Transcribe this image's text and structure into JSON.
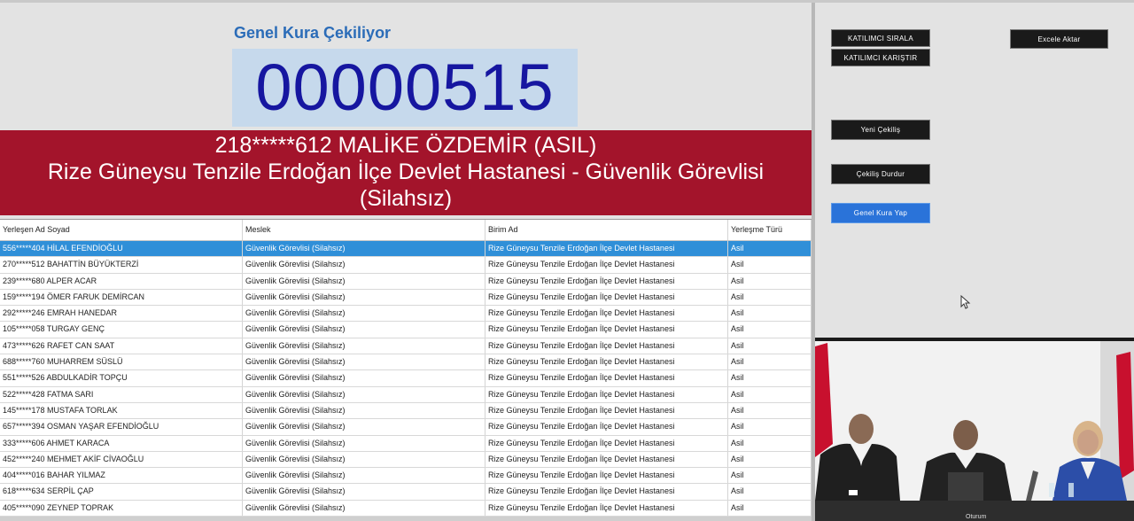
{
  "draw": {
    "title": "Genel Kura Çekiliyor",
    "counter": "00000515",
    "winner_line1": "218*****612 MALİKE ÖZDEMİR (ASIL)",
    "winner_line2": "Rize Güneysu Tenzile Erdoğan İlçe Devlet Hastanesi - Güvenlik Görevlisi",
    "winner_line3": "(Silahsız)"
  },
  "table": {
    "headers": [
      "Yerleşen Ad Soyad",
      "Meslek",
      "Birim Ad",
      "Yerleşme Türü"
    ],
    "rows": [
      [
        "556*****404 HİLAL EFENDİOĞLU",
        "Güvenlik Görevlisi (Silahsız)",
        "Rize Güneysu Tenzile Erdoğan İlçe Devlet Hastanesi",
        "Asil"
      ],
      [
        "270*****512 BAHATTİN BÜYÜKTERZİ",
        "Güvenlik Görevlisi (Silahsız)",
        "Rize Güneysu Tenzile Erdoğan İlçe Devlet Hastanesi",
        "Asil"
      ],
      [
        "239*****680 ALPER ACAR",
        "Güvenlik Görevlisi (Silahsız)",
        "Rize Güneysu Tenzile Erdoğan İlçe Devlet Hastanesi",
        "Asil"
      ],
      [
        "159*****194 ÖMER FARUK DEMİRCAN",
        "Güvenlik Görevlisi (Silahsız)",
        "Rize Güneysu Tenzile Erdoğan İlçe Devlet Hastanesi",
        "Asil"
      ],
      [
        "292*****246 EMRAH HANEDAR",
        "Güvenlik Görevlisi (Silahsız)",
        "Rize Güneysu Tenzile Erdoğan İlçe Devlet Hastanesi",
        "Asil"
      ],
      [
        "105*****058 TURGAY GENÇ",
        "Güvenlik Görevlisi (Silahsız)",
        "Rize Güneysu Tenzile Erdoğan İlçe Devlet Hastanesi",
        "Asil"
      ],
      [
        "473*****626 RAFET CAN SAAT",
        "Güvenlik Görevlisi (Silahsız)",
        "Rize Güneysu Tenzile Erdoğan İlçe Devlet Hastanesi",
        "Asil"
      ],
      [
        "688*****760 MUHARREM SÜSLÜ",
        "Güvenlik Görevlisi (Silahsız)",
        "Rize Güneysu Tenzile Erdoğan İlçe Devlet Hastanesi",
        "Asil"
      ],
      [
        "551*****526 ABDULKADİR TOPÇU",
        "Güvenlik Görevlisi (Silahsız)",
        "Rize Güneysu Tenzile Erdoğan İlçe Devlet Hastanesi",
        "Asil"
      ],
      [
        "522*****428 FATMA SARI",
        "Güvenlik Görevlisi (Silahsız)",
        "Rize Güneysu Tenzile Erdoğan İlçe Devlet Hastanesi",
        "Asil"
      ],
      [
        "145*****178 MUSTAFA TORLAK",
        "Güvenlik Görevlisi (Silahsız)",
        "Rize Güneysu Tenzile Erdoğan İlçe Devlet Hastanesi",
        "Asil"
      ],
      [
        "657*****394 OSMAN YAŞAR EFENDİOĞLU",
        "Güvenlik Görevlisi (Silahsız)",
        "Rize Güneysu Tenzile Erdoğan İlçe Devlet Hastanesi",
        "Asil"
      ],
      [
        "333*****606 AHMET KARACA",
        "Güvenlik Görevlisi (Silahsız)",
        "Rize Güneysu Tenzile Erdoğan İlçe Devlet Hastanesi",
        "Asil"
      ],
      [
        "452*****240 MEHMET AKİF CİVAOĞLU",
        "Güvenlik Görevlisi (Silahsız)",
        "Rize Güneysu Tenzile Erdoğan İlçe Devlet Hastanesi",
        "Asil"
      ],
      [
        "404*****016 BAHAR YILMAZ",
        "Güvenlik Görevlisi (Silahsız)",
        "Rize Güneysu Tenzile Erdoğan İlçe Devlet Hastanesi",
        "Asil"
      ],
      [
        "618*****634 SERPİL ÇAP",
        "Güvenlik Görevlisi (Silahsız)",
        "Rize Güneysu Tenzile Erdoğan İlçe Devlet Hastanesi",
        "Asil"
      ],
      [
        "405*****090 ZEYNEP TOPRAK",
        "Güvenlik Görevlisi (Silahsız)",
        "Rize Güneysu Tenzile Erdoğan İlçe Devlet Hastanesi",
        "Asil"
      ]
    ]
  },
  "buttons": {
    "sort_participants": "KATILIMCI SIRALA",
    "shuffle_participants": "KATILIMCI KARIŞTIR",
    "export_excel": "Excele Aktar",
    "new_draw": "Yeni Çekiliş",
    "stop_draw": "Çekiliş Durdur",
    "run_general_draw": "Genel Kura Yap"
  },
  "video": {
    "caption": "Oturum"
  },
  "colors": {
    "counter": "#1616a0",
    "banner": "#a3142b",
    "title": "#2b6cb8",
    "selected_row": "#2f8fd8",
    "primary_button": "#2a73d9"
  }
}
